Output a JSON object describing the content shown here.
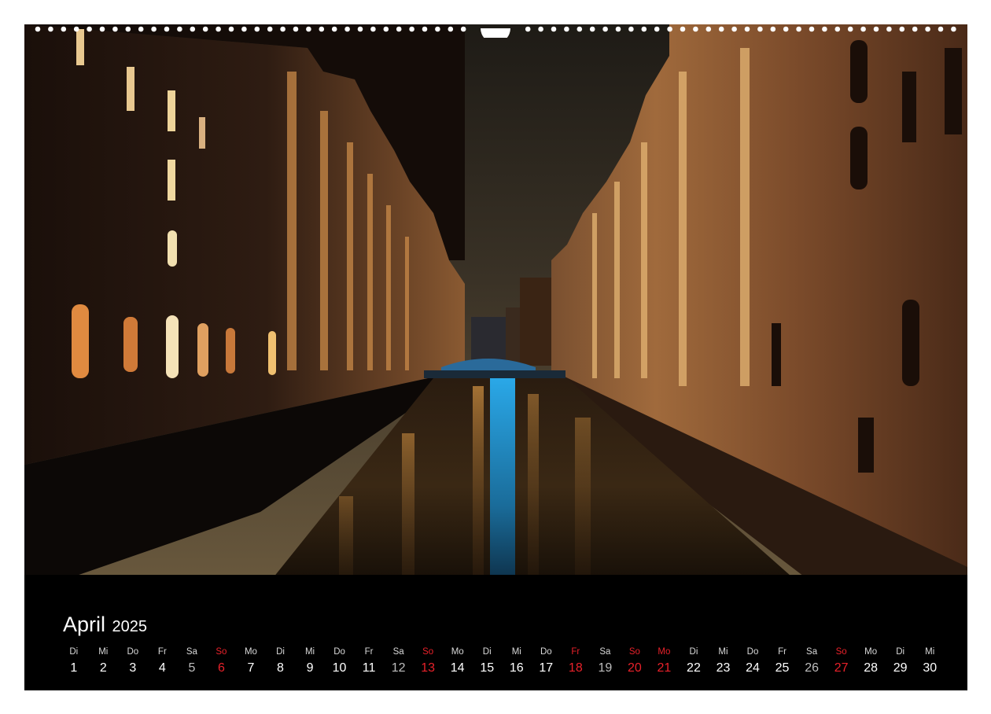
{
  "calendar": {
    "month": "April",
    "year": "2025",
    "days": [
      {
        "wd": "Di",
        "d": "1",
        "type": "normal"
      },
      {
        "wd": "Mi",
        "d": "2",
        "type": "normal"
      },
      {
        "wd": "Do",
        "d": "3",
        "type": "normal"
      },
      {
        "wd": "Fr",
        "d": "4",
        "type": "normal"
      },
      {
        "wd": "Sa",
        "d": "5",
        "type": "sat"
      },
      {
        "wd": "So",
        "d": "6",
        "type": "hol"
      },
      {
        "wd": "Mo",
        "d": "7",
        "type": "normal"
      },
      {
        "wd": "Di",
        "d": "8",
        "type": "normal"
      },
      {
        "wd": "Mi",
        "d": "9",
        "type": "normal"
      },
      {
        "wd": "Do",
        "d": "10",
        "type": "normal"
      },
      {
        "wd": "Fr",
        "d": "11",
        "type": "normal"
      },
      {
        "wd": "Sa",
        "d": "12",
        "type": "sat"
      },
      {
        "wd": "So",
        "d": "13",
        "type": "hol"
      },
      {
        "wd": "Mo",
        "d": "14",
        "type": "normal"
      },
      {
        "wd": "Di",
        "d": "15",
        "type": "normal"
      },
      {
        "wd": "Mi",
        "d": "16",
        "type": "normal"
      },
      {
        "wd": "Do",
        "d": "17",
        "type": "normal"
      },
      {
        "wd": "Fr",
        "d": "18",
        "type": "hol"
      },
      {
        "wd": "Sa",
        "d": "19",
        "type": "sat"
      },
      {
        "wd": "So",
        "d": "20",
        "type": "hol"
      },
      {
        "wd": "Mo",
        "d": "21",
        "type": "hol"
      },
      {
        "wd": "Di",
        "d": "22",
        "type": "normal"
      },
      {
        "wd": "Mi",
        "d": "23",
        "type": "normal"
      },
      {
        "wd": "Do",
        "d": "24",
        "type": "normal"
      },
      {
        "wd": "Fr",
        "d": "25",
        "type": "normal"
      },
      {
        "wd": "Sa",
        "d": "26",
        "type": "sat"
      },
      {
        "wd": "So",
        "d": "27",
        "type": "hol"
      },
      {
        "wd": "Mo",
        "d": "28",
        "type": "normal"
      },
      {
        "wd": "Di",
        "d": "29",
        "type": "normal"
      },
      {
        "wd": "Mi",
        "d": "30",
        "type": "normal"
      }
    ]
  },
  "colors": {
    "holiday": "#e8212a",
    "background": "#000000",
    "text": "#ffffff"
  }
}
